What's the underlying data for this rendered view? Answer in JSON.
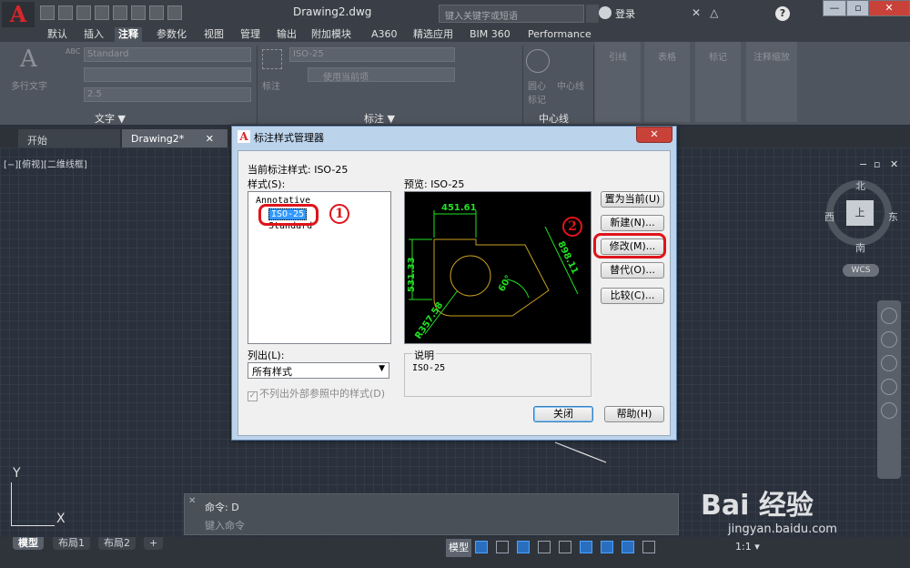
{
  "app": {
    "document_title": "Drawing2.dwg",
    "search_placeholder": "键入关键字或短语",
    "login_label": "登录",
    "help_label": "?"
  },
  "ribbon_tabs": [
    "默认",
    "插入",
    "注释",
    "参数化",
    "视图",
    "管理",
    "输出",
    "附加模块",
    "A360",
    "精选应用",
    "BIM 360",
    "Performance"
  ],
  "active_ribbon_tab": "注释",
  "ribbon": {
    "text_panel": {
      "title": "文字 ▼",
      "big_button_label": "多行文字",
      "text_style_value": "Standard",
      "text_height_value": "2.5",
      "abc_label": "ABC"
    },
    "dim_panel": {
      "title": "标注 ▼",
      "dim_style_value": "ISO-25",
      "layer_value": "使用当前项",
      "dim_button_label": "标注"
    },
    "centerline_panel": {
      "title": "中心线",
      "center_mark_label": "圆心\n标记",
      "centerline_label": "中心线"
    },
    "ghost_panels": [
      "引线",
      "表格",
      "标记",
      "注释缩放"
    ]
  },
  "doc_tabs": {
    "start": "开始",
    "drawing": "Drawing2*",
    "close": "✕"
  },
  "viewport": {
    "label": "[−][俯视][二维线框]",
    "controls": [
      "−",
      "▫",
      "✕"
    ],
    "viewcube": {
      "north": "北",
      "south": "南",
      "east": "东",
      "west": "西",
      "face": "上",
      "wcs": "WCS"
    }
  },
  "ucs": {
    "x": "X",
    "y": "Y"
  },
  "command_line": {
    "history": "命令: D",
    "placeholder": "键入命令"
  },
  "layout_tabs": [
    "模型",
    "布局1",
    "布局2",
    "+"
  ],
  "status_bar": {
    "model_label": "模型",
    "scale": "1:1 ▾"
  },
  "dialog": {
    "title": "标注样式管理器",
    "current_style_label": "当前标注样式: ISO-25",
    "styles_label": "样式(S):",
    "styles": [
      "Annotative",
      "ISO-25",
      "Standard"
    ],
    "selected_style": "ISO-25",
    "preview_label": "预览: ISO-25",
    "list_label": "列出(L):",
    "list_value": "所有样式",
    "xref_checkbox_label": "不列出外部参照中的样式(D)",
    "description_title": "说明",
    "description_text": "ISO-25",
    "buttons": {
      "set_current": "置为当前(U)",
      "new": "新建(N)...",
      "modify": "修改(M)...",
      "override": "替代(O)...",
      "compare": "比较(C)...",
      "close": "关闭",
      "help": "帮助(H)"
    },
    "preview_dims": {
      "top": "451.61",
      "left": "531.33",
      "right": "898.11",
      "angle": "60°",
      "radius": "R357.58"
    },
    "annotations": [
      "1",
      "2"
    ]
  },
  "watermark": {
    "brand": "Bai  经验",
    "url": "jingyan.baidu.com"
  },
  "colors": {
    "accent_red": "#e0141a",
    "dim_green": "#22e022",
    "geometry_gold": "#c8a020",
    "selection_blue": "#3399ff"
  }
}
